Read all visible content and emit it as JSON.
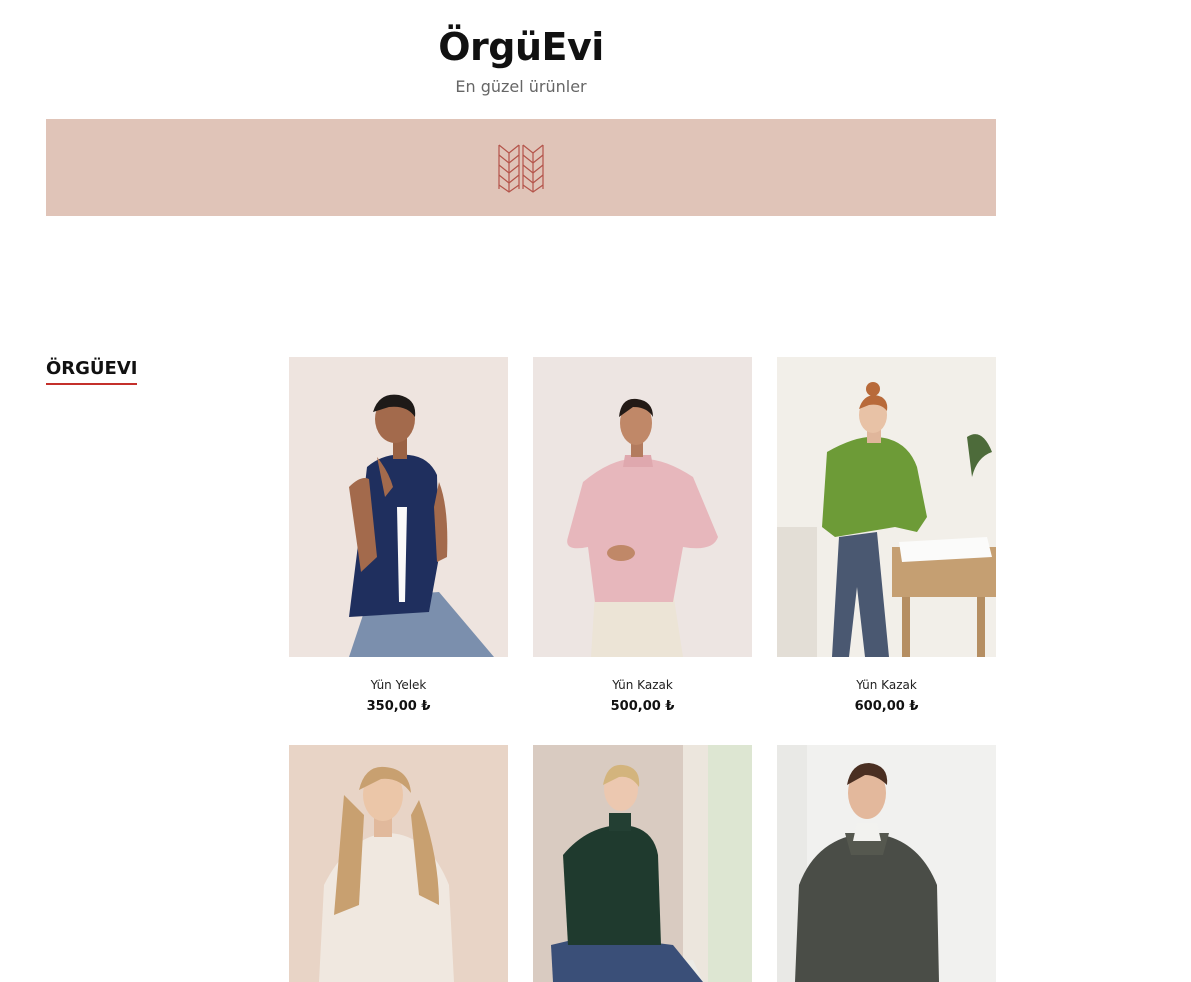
{
  "site": {
    "title": "ÖrgüEvi",
    "tagline": "En güzel ürünler"
  },
  "banner": {
    "logo_icon": "knit-stitch-icon",
    "background": "#e0c4b8"
  },
  "sidebar": {
    "heading": "ÖRGÜEVI",
    "accent_color": "#c4302b"
  },
  "products": [
    {
      "name": "Yün Yelek",
      "price": "350,00 ₺",
      "image": "woman-in-navy-knit-vest"
    },
    {
      "name": "Yün Kazak",
      "price": "500,00 ₺",
      "image": "woman-in-pink-knit-sweater"
    },
    {
      "name": "Yün Kazak",
      "price": "600,00 ₺",
      "image": "woman-in-green-knit-sweater"
    },
    {
      "name": "",
      "price": "",
      "image": "woman-in-cream-knit-sweater"
    },
    {
      "name": "",
      "price": "",
      "image": "woman-in-dark-green-turtleneck"
    },
    {
      "name": "",
      "price": "",
      "image": "man-in-charcoal-knit-sweater"
    }
  ]
}
